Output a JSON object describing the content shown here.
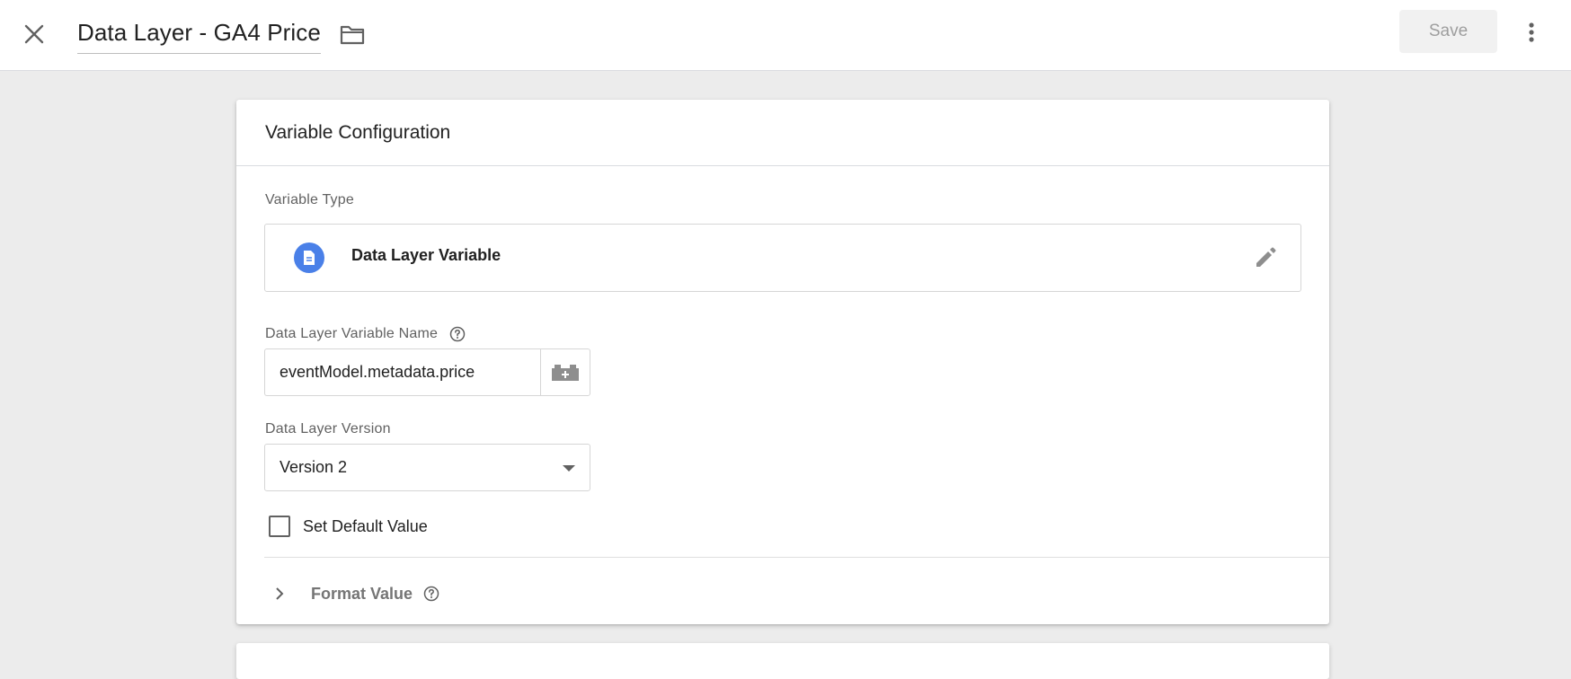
{
  "header": {
    "title": "Data Layer - GA4 Price",
    "save_label": "Save"
  },
  "card": {
    "title": "Variable Configuration",
    "variable_type_label": "Variable Type",
    "variable_type": "Data Layer Variable",
    "variable_name_label": "Data Layer Variable Name",
    "variable_name_value": "eventModel.metadata.price",
    "version_label": "Data Layer Version",
    "version_value": "Version 2",
    "default_value_label": "Set Default Value",
    "default_value_checked": false,
    "format_value_label": "Format Value"
  },
  "icons": {
    "close": "close-icon",
    "folder": "folder-icon",
    "more": "more-vert-icon",
    "type": "document-icon",
    "edit": "pencil-icon",
    "help": "help-circle-icon",
    "variable_picker": "add-variable-icon",
    "expand": "chevron-right-icon"
  },
  "colors": {
    "accent": "#4a80e8",
    "background": "#ececec"
  }
}
